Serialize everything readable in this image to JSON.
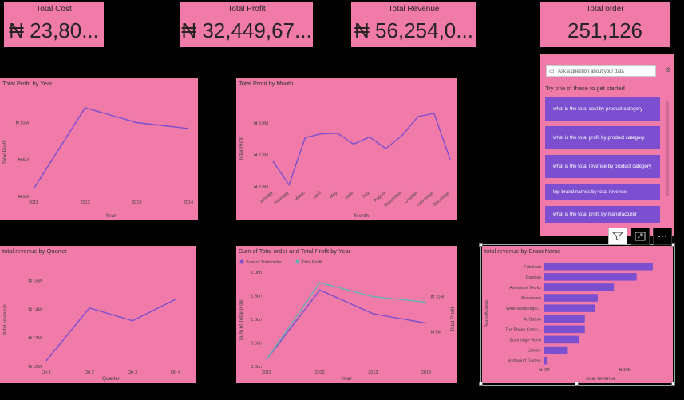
{
  "kpis": {
    "total_cost": {
      "title": "Total Cost",
      "value": "₦ 23,80..."
    },
    "total_profit": {
      "title": "Total Profit",
      "value": "₦ 32,449,67..."
    },
    "total_revenue": {
      "title": "Total Revenue",
      "value": "₦ 56,254,0..."
    },
    "total_order": {
      "title": "Total order",
      "value": "251,126"
    }
  },
  "colors": {
    "card": "#f07aa8",
    "line": "#7a4fd0",
    "line2": "#5fb3b3",
    "button": "#7b4fcf"
  },
  "qa": {
    "placeholder": "Ask a question about your data",
    "try_label": "Try one of these to get started",
    "suggestions": [
      "what is the total cost by product category",
      "what is the total profit by product category",
      "what is the total revenue by product category",
      "top brand names by total revenue",
      "what is the total profit by manufacturer"
    ]
  },
  "toolbar": {
    "icons": [
      "filter-icon",
      "focus-mode-icon",
      "more-options-icon"
    ],
    "more": "⋯"
  },
  "chart_data": [
    {
      "id": "profit_by_year",
      "type": "line",
      "title": "Total Profit by Year",
      "xlabel": "Year",
      "ylabel": "Total Profit",
      "categories": [
        "2011",
        "2012",
        "2013",
        "2014"
      ],
      "values": [
        1.0,
        12.0,
        10.0,
        9.2
      ],
      "ylim": [
        0,
        12
      ],
      "yticks": [
        {
          "v": 0,
          "label": "₦ 0M"
        },
        {
          "v": 5,
          "label": "₦ 5M"
        },
        {
          "v": 10,
          "label": "₦ 10M"
        }
      ]
    },
    {
      "id": "profit_by_month",
      "type": "line",
      "title": "Total Profit by Month",
      "xlabel": "Month",
      "ylabel": "Total Profit",
      "categories": [
        "January",
        "February",
        "March",
        "April",
        "May",
        "June",
        "July",
        "August",
        "September",
        "October",
        "November",
        "December"
      ],
      "values": [
        2.4,
        2.03,
        2.77,
        2.83,
        2.84,
        2.67,
        2.78,
        2.6,
        2.8,
        3.1,
        3.15,
        2.43
      ],
      "ylim": [
        2.0,
        3.2
      ],
      "yticks": [
        {
          "v": 2.0,
          "label": "₦ 2.0M"
        },
        {
          "v": 2.5,
          "label": "₦ 2.5M"
        },
        {
          "v": 3.0,
          "label": "₦ 3.0M"
        }
      ]
    },
    {
      "id": "revenue_by_quarter",
      "type": "line",
      "title": "total revenue by Quarter",
      "xlabel": "Quarter",
      "ylabel": "total revenue",
      "categories": [
        "Qtr 1",
        "Qtr 2",
        "Qtr 3",
        "Qtr 4"
      ],
      "values": [
        12.2,
        14.05,
        13.6,
        14.35
      ],
      "ylim": [
        12,
        15.3
      ],
      "yticks": [
        {
          "v": 12,
          "label": "₦ 12M"
        },
        {
          "v": 13,
          "label": "₦ 13M"
        },
        {
          "v": 14,
          "label": "₦ 14M"
        },
        {
          "v": 15,
          "label": "₦ 15M"
        }
      ]
    },
    {
      "id": "order_profit_by_year",
      "type": "line",
      "title": "Sum of Total order and Total Profit by Year",
      "xlabel": "Year",
      "ylabel": "Sum of Total order",
      "ylabel2": "Total Profit",
      "categories": [
        "2011",
        "2012",
        "2013",
        "2014"
      ],
      "series": [
        {
          "name": "Sum of Total order",
          "values": [
            0.15,
            1.62,
            1.12,
            0.92
          ],
          "axis": "left"
        },
        {
          "name": "Total Profit",
          "values": [
            1.0,
            12.0,
            10.0,
            9.2
          ],
          "axis": "right"
        }
      ],
      "ylim": [
        0,
        2.0
      ],
      "ylim2": [
        0,
        13.5
      ],
      "yticks": [
        {
          "v": 0,
          "label": "0.0bn"
        },
        {
          "v": 0.5,
          "label": "0.5bn"
        },
        {
          "v": 1.0,
          "label": "1.0bn"
        },
        {
          "v": 1.5,
          "label": "1.5bn"
        },
        {
          "v": 2.0,
          "label": "2.0bn"
        }
      ],
      "yticks2": [
        {
          "v": 5,
          "label": "₦ 5M"
        },
        {
          "v": 10,
          "label": "₦ 10M"
        }
      ]
    },
    {
      "id": "revenue_by_brand",
      "type": "bar",
      "title": "total revenue by BrandName",
      "xlabel": "total revenue",
      "ylabel": "BrandName",
      "categories": [
        "Fabrikam",
        "Contoso",
        "Adventure Works",
        "Proseware",
        "Wide World Impo...",
        "A. Datum",
        "The Phone Comp...",
        "Southridge Video",
        "Litware",
        "Northwind Traders"
      ],
      "values": [
        13.4,
        11.4,
        8.6,
        6.6,
        6.3,
        5.0,
        5.0,
        4.3,
        2.9,
        0.3
      ],
      "xlim": [
        0,
        14
      ],
      "xticks": [
        {
          "v": 0,
          "label": "₦ 0M"
        },
        {
          "v": 10,
          "label": "₦ 10M"
        }
      ]
    }
  ]
}
